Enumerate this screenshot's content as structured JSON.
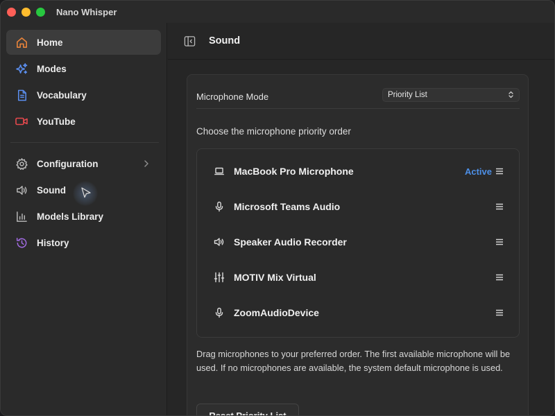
{
  "window": {
    "title": "Nano Whisper"
  },
  "sidebar": {
    "items": [
      {
        "label": "Home",
        "icon": "home-icon",
        "color": "#e8833a"
      },
      {
        "label": "Modes",
        "icon": "sparkles-icon",
        "color": "#5b8ff0"
      },
      {
        "label": "Vocabulary",
        "icon": "document-icon",
        "color": "#5b8ff0"
      },
      {
        "label": "YouTube",
        "icon": "video-icon",
        "color": "#e5484d"
      },
      {
        "label": "Configuration",
        "icon": "gear-icon",
        "color": "#bdbdbd"
      },
      {
        "label": "Sound",
        "icon": "speaker-icon",
        "color": "#bdbdbd"
      },
      {
        "label": "Models Library",
        "icon": "bar-chart-icon",
        "color": "#bdbdbd"
      },
      {
        "label": "History",
        "icon": "history-icon",
        "color": "#a06ae0"
      }
    ]
  },
  "main": {
    "title": "Sound",
    "microphone_mode": {
      "label": "Microphone Mode",
      "value": "Priority List"
    },
    "priority_heading": "Choose the microphone priority order",
    "microphones": [
      {
        "name": "MacBook Pro Microphone",
        "icon": "laptop-icon",
        "status": "Active"
      },
      {
        "name": "Microsoft Teams Audio",
        "icon": "microphone-icon",
        "status": ""
      },
      {
        "name": "Speaker Audio Recorder",
        "icon": "speaker-icon",
        "status": ""
      },
      {
        "name": "MOTIV Mix Virtual",
        "icon": "sliders-icon",
        "status": ""
      },
      {
        "name": "ZoomAudioDevice",
        "icon": "microphone-icon",
        "status": ""
      }
    ],
    "help_text": "Drag microphones to your preferred order. The first available microphone will be used. If no microphones are available, the system default microphone is used.",
    "reset_button": "Reset Priority List"
  },
  "colors": {
    "accent": "#4d8fe6",
    "background": "#262626",
    "sidebar": "#2a2a2a"
  }
}
